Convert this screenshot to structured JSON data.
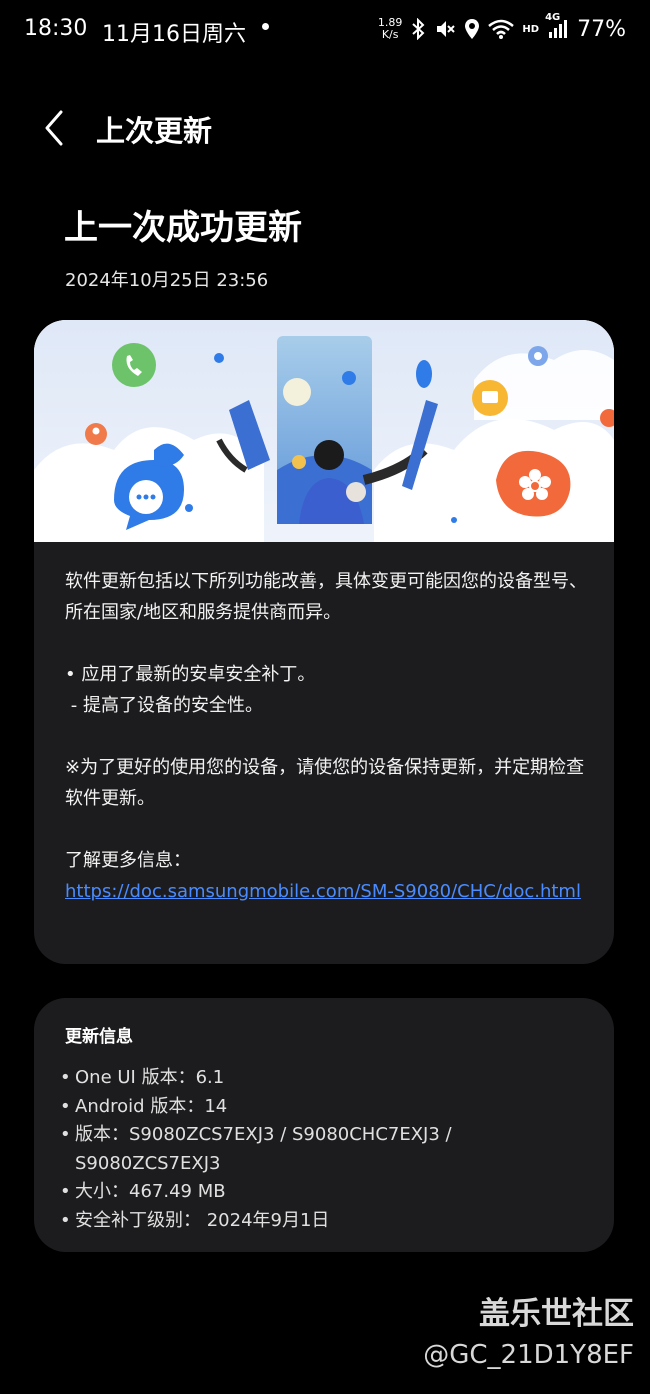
{
  "status_bar": {
    "time": "18:30",
    "date": "11月16日周六",
    "net_speed_value": "1.89",
    "net_speed_unit": "K/s",
    "hd_label": "HD",
    "network_label": "4G",
    "battery": "77%",
    "icons": [
      "bluetooth-icon",
      "mute-icon",
      "location-icon",
      "wifi-icon",
      "signal-icon"
    ]
  },
  "header": {
    "back_icon": "chevron-left-icon",
    "title": "上次更新"
  },
  "main": {
    "title": "上一次成功更新",
    "date": "2024年10月25日 23:56"
  },
  "notes": {
    "intro": "软件更新包括以下所列功能改善，具体变更可能因您的设备型号、所在国家/地区和服务提供商而异。",
    "bullet": "• 应用了最新的安卓安全补丁。",
    "sub_bullet": " - 提高了设备的安全性。",
    "note": "※为了更好的使用您的设备，请使您的设备保持更新，并定期检查软件更新。",
    "more_info_label": "了解更多信息：",
    "link": "https://doc.samsungmobile.com/SM-S9080/CHC/doc.html"
  },
  "update_info": {
    "title": "更新信息",
    "items": [
      "One UI 版本：6.1",
      "Android 版本：14",
      "版本：S9080ZCS7EXJ3 / S9080CHC7EXJ3 / S9080ZCS7EXJ3",
      "大小：467.49 MB",
      "安全补丁级别： 2024年9月1日"
    ]
  },
  "watermark": {
    "site": "盖乐世社区",
    "user": "@GC_21D1Y8EF"
  },
  "colors": {
    "background": "#000000",
    "card": "#1c1c1e",
    "link": "#4a8cff"
  }
}
